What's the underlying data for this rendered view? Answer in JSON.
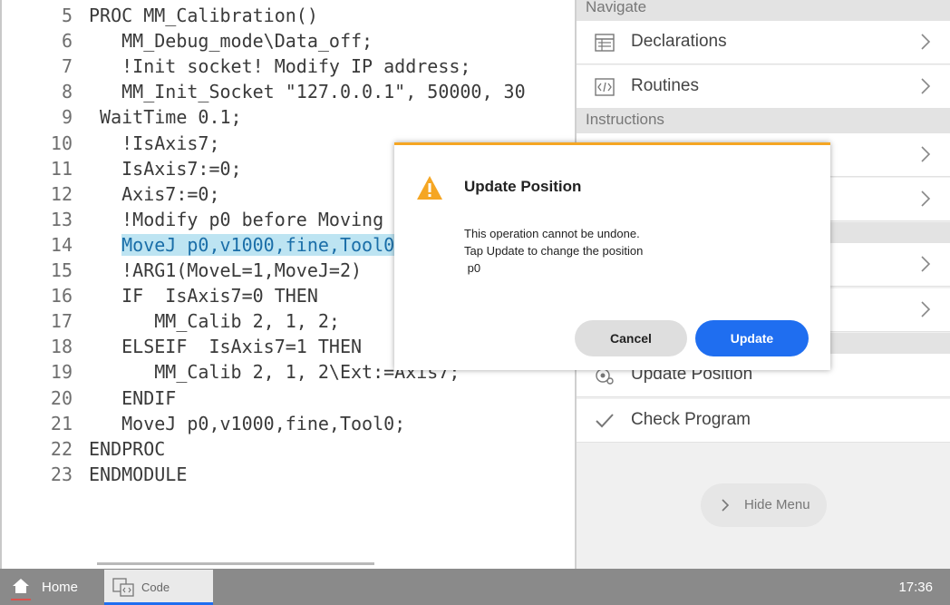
{
  "editor": {
    "lines": [
      {
        "num": "5",
        "text": "PROC MM_Calibration()"
      },
      {
        "num": "6",
        "text": "   MM_Debug_mode\\Data_off;"
      },
      {
        "num": "7",
        "text": "   !Init socket! Modify IP address;"
      },
      {
        "num": "8",
        "text": "   MM_Init_Socket \"127.0.0.1\", 50000, 30"
      },
      {
        "num": "9",
        "text": " WaitTime 0.1;"
      },
      {
        "num": "10",
        "text": "   !IsAxis7;"
      },
      {
        "num": "11",
        "text": "   IsAxis7:=0;"
      },
      {
        "num": "12",
        "text": "   Axis7:=0;"
      },
      {
        "num": "13",
        "text": "   !Modify p0 before Moving"
      },
      {
        "num": "14",
        "text": "   ",
        "highlight": "MoveJ p0,v1000,fine,Tool0;"
      },
      {
        "num": "15",
        "text": "   !ARG1(MoveL=1,MoveJ=2)"
      },
      {
        "num": "16",
        "text": "   IF  IsAxis7=0 THEN"
      },
      {
        "num": "17",
        "text": "      MM_Calib 2, 1, 2;"
      },
      {
        "num": "18",
        "text": "   ELSEIF  IsAxis7=1 THEN"
      },
      {
        "num": "19",
        "text": "      MM_Calib 2, 1, 2\\Ext:=Axis7;"
      },
      {
        "num": "20",
        "text": "   ENDIF"
      },
      {
        "num": "21",
        "text": "   MoveJ p0,v1000,fine,Tool0;"
      },
      {
        "num": "22",
        "text": "ENDPROC"
      },
      {
        "num": "23",
        "text": "ENDMODULE"
      }
    ]
  },
  "menu": {
    "navigate_header": "Navigate",
    "declarations": "Declarations",
    "routines": "Routines",
    "instructions_header": "Instructions",
    "update_position": "Update Position",
    "check_program": "Check Program",
    "hide_menu": "Hide Menu"
  },
  "dialog": {
    "title": "Update Position",
    "message_line1": "This operation cannot be undone.",
    "message_line2": "Tap Update to change the position",
    "message_line3": " p0",
    "cancel_label": "Cancel",
    "update_label": "Update"
  },
  "taskbar": {
    "home_label": "Home",
    "code_tab_label": "Code",
    "clock": "17:36"
  },
  "colors": {
    "accent_blue": "#1f6ef0",
    "warning_orange": "#f5a623",
    "code_highlight": "#bde4f2"
  },
  "icons": {
    "warning": "warning-triangle-icon",
    "declarations": "declarations-list-icon",
    "routines": "code-brackets-icon",
    "update_position": "target-position-icon",
    "check_program": "checkmark-icon",
    "chevron": "chevron-right-icon",
    "home": "home-icon",
    "code": "code-file-icon"
  }
}
